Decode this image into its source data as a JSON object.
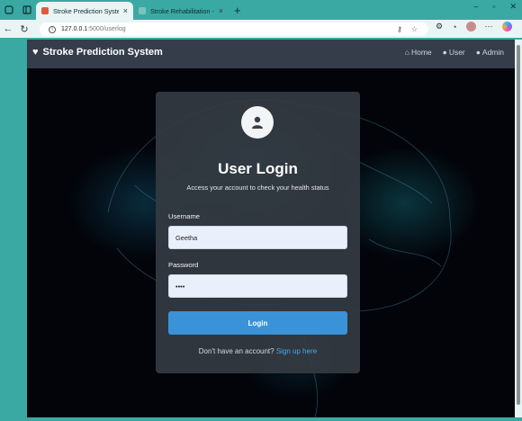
{
  "browser": {
    "tabs": [
      {
        "title": "Stroke Prediction System",
        "active": true
      },
      {
        "title": "Stroke Rehabilitation - ThingSpea",
        "active": false
      }
    ],
    "url_host": "127.0.0.1",
    "url_path": ":5000/userlog",
    "new_tab_symbol": "+",
    "close_symbol": "×",
    "window_controls": [
      "–",
      "▫",
      "✕"
    ]
  },
  "navbar": {
    "brand": "Stroke Prediction System",
    "links": [
      "Home",
      "User",
      "Admin"
    ]
  },
  "login": {
    "title": "User Login",
    "subtitle": "Access your account to check your health status",
    "username_label": "Username",
    "username_value": "Geetha",
    "password_label": "Password",
    "password_value": "••••",
    "login_button": "Login",
    "signup_prompt": "Don't have an account?",
    "signup_link": "Sign up here"
  },
  "colors": {
    "chrome": "#3aa9a4",
    "navbar": "#353d4a",
    "card": "#343a42",
    "button": "#3a93d8",
    "link": "#4aa6ea"
  }
}
